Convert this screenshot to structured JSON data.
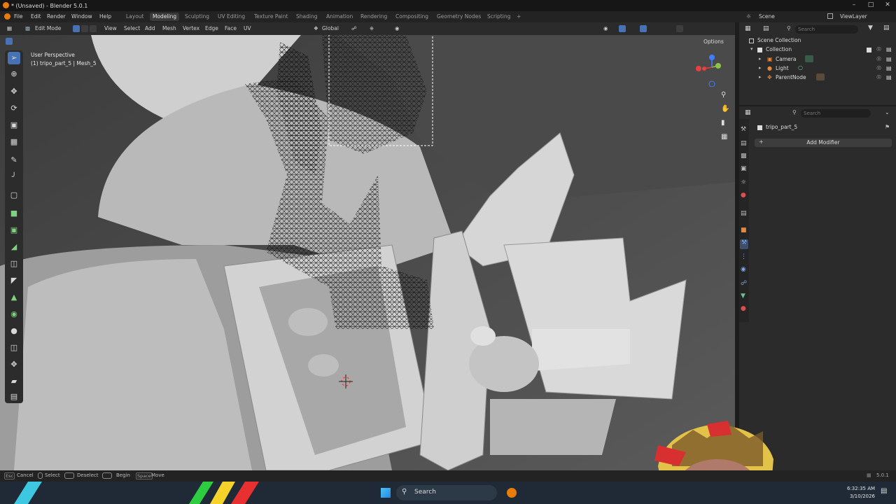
{
  "window": {
    "title": "* (Unsaved) - Blender 5.0.1"
  },
  "menu": {
    "items": [
      "File",
      "Edit",
      "Render",
      "Window",
      "Help"
    ],
    "workspaces": [
      "Layout",
      "Modeling",
      "Sculpting",
      "UV Editing",
      "Texture Paint",
      "Shading",
      "Animation",
      "Rendering",
      "Compositing",
      "Geometry Nodes",
      "Scripting"
    ],
    "active_workspace": "Modeling",
    "add_tab": "+",
    "scene_label": "Scene",
    "view_layer_label": "ViewLayer"
  },
  "header": {
    "mode": "Edit Mode",
    "menus": [
      "View",
      "Select",
      "Add",
      "Mesh",
      "Vertex",
      "Edge",
      "Face",
      "UV"
    ],
    "transform_orientation": "Global",
    "options_label": "Options"
  },
  "viewport": {
    "perspective_label": "User Perspective",
    "object_label": "(1) tripo_part_5 | Mesh_5"
  },
  "outliner": {
    "search_placeholder": "Search",
    "root": "Scene Collection",
    "collection": "Collection",
    "items": [
      "Camera",
      "Light",
      "ParentNode"
    ]
  },
  "properties": {
    "search_placeholder": "Search",
    "object_name": "tripo_part_5",
    "add_modifier_label": "Add Modifier"
  },
  "status_bar": {
    "hints": [
      {
        "key": "Esc",
        "label": "Cancel"
      },
      {
        "key": "",
        "label": "Select"
      },
      {
        "key": "",
        "label": "Deselect"
      },
      {
        "key": "",
        "label": "Begin"
      },
      {
        "key": "Space",
        "label": "Move"
      }
    ],
    "version": "5.0.1"
  },
  "taskbar": {
    "search_label": "Search",
    "time": "6:32:35 AM",
    "date": "3/10/2026"
  },
  "colors": {
    "accent": "#4772b3",
    "viewport_bg": "#5c5c5c",
    "panel_bg": "#2b2b2b"
  }
}
